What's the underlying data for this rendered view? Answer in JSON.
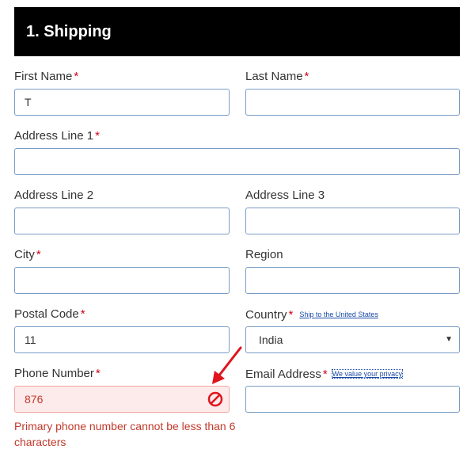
{
  "header": {
    "title": "1. Shipping"
  },
  "form": {
    "first_name": {
      "label": "First Name",
      "required": "*",
      "value": "T"
    },
    "last_name": {
      "label": "Last Name",
      "required": "*",
      "value": ""
    },
    "address1": {
      "label": "Address Line 1",
      "required": "*",
      "value": ""
    },
    "address2": {
      "label": "Address Line 2",
      "value": ""
    },
    "address3": {
      "label": "Address Line 3",
      "value": ""
    },
    "city": {
      "label": "City",
      "required": "*",
      "value": ""
    },
    "region": {
      "label": "Region",
      "value": ""
    },
    "postal_code": {
      "label": "Postal Code",
      "required": "*",
      "value": "11"
    },
    "country": {
      "label": "Country",
      "required": "*",
      "link": "Ship to the United States",
      "value": "India"
    },
    "phone": {
      "label": "Phone Number",
      "required": "*",
      "value": "876",
      "error": "Primary phone number cannot be less than 6 characters"
    },
    "email": {
      "label": "Email Address",
      "required": "*",
      "link": "We value your privacy",
      "value": ""
    }
  },
  "colors": {
    "error": "#c0392b",
    "error_bg": "#fdeaea",
    "required": "#d0021b",
    "border": "#7a9cc6",
    "annotation_arrow": "#e0141e"
  },
  "icons": {
    "error_icon": "prohibited-icon",
    "select_icon": "caret-down-icon",
    "annotation": "red-arrow-icon"
  }
}
